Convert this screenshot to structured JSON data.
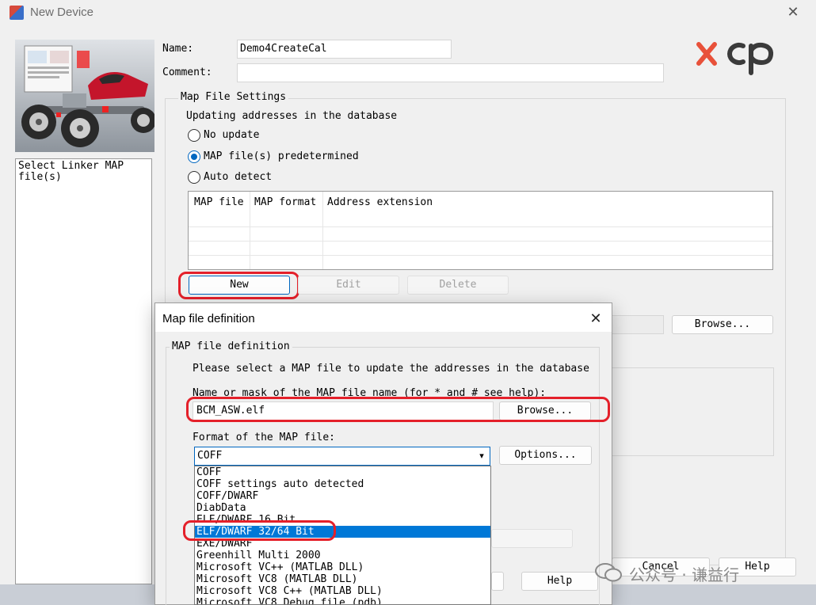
{
  "window": {
    "title": "New Device"
  },
  "wizard": {
    "hint": "Select Linker MAP\nfile(s)"
  },
  "form": {
    "name_label": "Name:",
    "name_value": "Demo4CreateCal",
    "comment_label": "Comment:",
    "comment_value": ""
  },
  "logo": {
    "text": "XCP",
    "colors": {
      "x": "#e8513a",
      "cp": "#3b3b3b"
    }
  },
  "map_settings": {
    "group_title": "Map File Settings",
    "subtitle": "Updating addresses in the database",
    "options": [
      {
        "label": "No update",
        "checked": false
      },
      {
        "label": "MAP file(s) predetermined",
        "checked": true
      },
      {
        "label": "Auto detect",
        "checked": false
      }
    ],
    "table": {
      "columns": [
        "MAP file",
        "MAP format",
        "Address extension"
      ],
      "rows": []
    },
    "buttons": {
      "new": "New",
      "edit": "Edit",
      "delete": "Delete"
    },
    "browse": "Browse..."
  },
  "main_buttons": {
    "cancel": "Cancel",
    "help": "Help"
  },
  "dialog": {
    "title": "Map file definition",
    "group_title": "MAP file definition",
    "instruction": "Please select a MAP file to update the addresses in the database",
    "name_label": "Name or mask of the MAP file name (for * and # see help):",
    "name_value": "BCM_ASW.elf",
    "browse": "Browse...",
    "format_label": "Format of the MAP file:",
    "format_value": "COFF",
    "options_button": "Options...",
    "help": "Help",
    "format_options": [
      "COFF",
      "COFF settings auto detected",
      "COFF/DWARF",
      "DiabData",
      "ELF/DWARF 16 Bit",
      "ELF/DWARF 32/64 Bit",
      "EXE/DWARF",
      "Greenhill Multi 2000",
      "Microsoft VC++ (MATLAB DLL)",
      "Microsoft VC8 (MATLAB DLL)",
      "Microsoft VC8 C++ (MATLAB DLL)",
      "Microsoft VC8 Debug file (pdb)"
    ],
    "highlighted_option": "ELF/DWARF 32/64 Bit"
  },
  "watermark": {
    "text": "公众号 · 谦益行"
  },
  "colors": {
    "accent": "#0067c0",
    "selection": "#0078d7",
    "annotation": "#e4202a"
  }
}
